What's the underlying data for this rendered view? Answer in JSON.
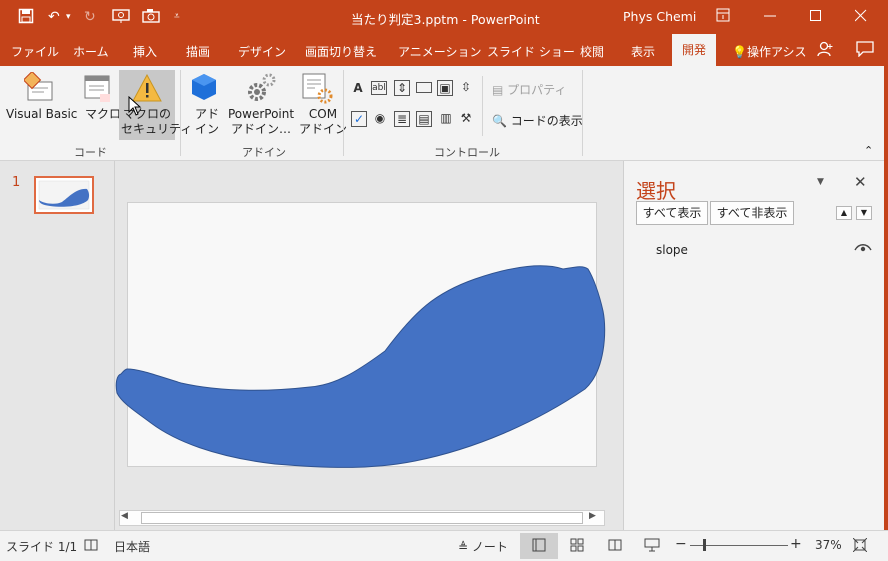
{
  "titlebar": {
    "filename": "当たり判定3.pptm",
    "separator": "-",
    "app": "PowerPoint",
    "user": "Phys Chemi"
  },
  "tabs": [
    "ファイル",
    "ホーム",
    "挿入",
    "描画",
    "デザイン",
    "画面切り替え",
    "アニメーション",
    "スライド ショー",
    "校閲",
    "表示",
    "開発"
  ],
  "active_tab": "開発",
  "tell_me": "操作アシス",
  "ribbon": {
    "code": {
      "visual_basic": "Visual Basic",
      "macro": "マクロ",
      "macro_security_1": "マクロの",
      "macro_security_2": "セキュリティ",
      "group": "コード"
    },
    "addins": {
      "addin_1": "アド",
      "addin_2": "イン",
      "ppt_addin_1": "PowerPoint",
      "ppt_addin_2": "アドイン…",
      "com_addin_1": "COM",
      "com_addin_2": "アドイン",
      "group": "アドイン"
    },
    "controls": {
      "properties": "プロパティ",
      "view_code": "コードの表示",
      "group": "コントロール"
    }
  },
  "thumbnail": {
    "number": "1"
  },
  "selection_pane": {
    "title": "選択",
    "show_all": "すべて表示",
    "hide_all": "すべて非表示",
    "items": [
      {
        "name": "slope",
        "visible": true
      }
    ]
  },
  "statusbar": {
    "slide": "スライド 1/1",
    "language": "日本語",
    "notes": "ノート",
    "zoom": "37%",
    "minus": "−",
    "plus": "+"
  },
  "colors": {
    "accent": "#c4431a",
    "shape_fill": "#4472c4",
    "shape_stroke": "#2f528f"
  }
}
